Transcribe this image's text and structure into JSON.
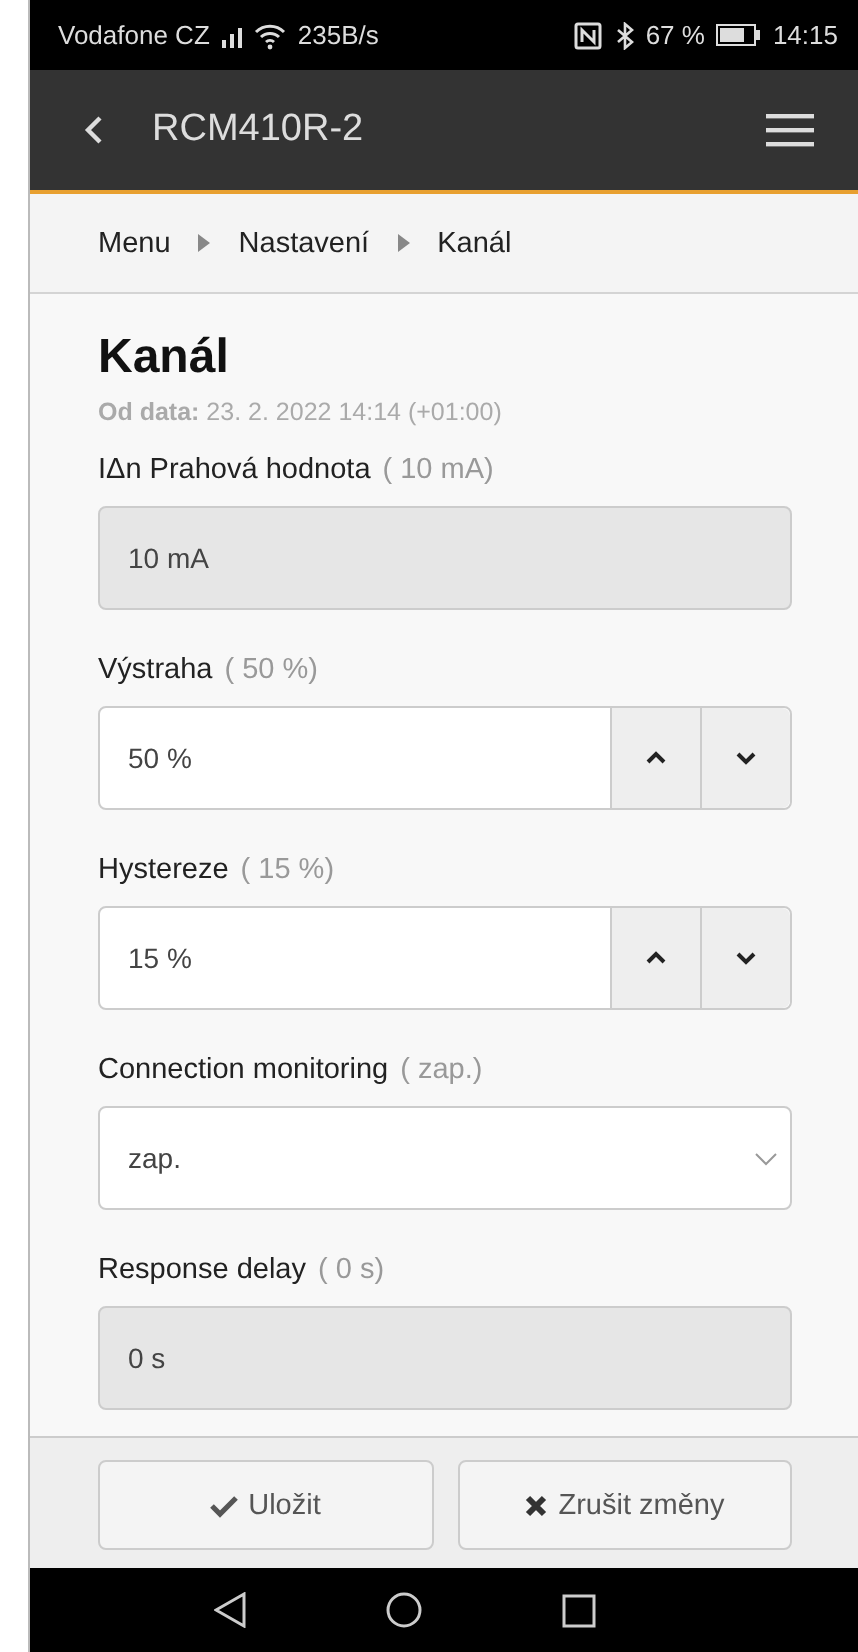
{
  "status_bar": {
    "carrier": "Vodafone CZ",
    "speed": "235B/s",
    "battery": "67 %",
    "time": "14:15"
  },
  "app_bar": {
    "title": "RCM410R-2"
  },
  "breadcrumb": [
    "Menu",
    "Nastavení",
    "Kanál"
  ],
  "page": {
    "title": "Kanál",
    "date": "**Od data:** 23. 2. 2022 14:14 (+01:00)"
  },
  "fields": [
    {
      "kind": "readonly",
      "label": "IΔn Prahová hodnota",
      "hint": "( 10 mA)",
      "value": "10 mA"
    },
    {
      "kind": "spinner",
      "label": "Výstraha",
      "hint": "( 50 %)",
      "value": "50 %"
    },
    {
      "kind": "spinner",
      "label": "Hystereze",
      "hint": "( 15 %)",
      "value": "15 %"
    },
    {
      "kind": "select",
      "label": "Connection monitoring",
      "hint": "( zap.)",
      "value": "zap."
    },
    {
      "kind": "readonly",
      "label": "Response delay",
      "hint": "( 0 s)",
      "value": "0 s"
    }
  ],
  "footer": [
    {
      "kind": "save",
      "label": "Uložit"
    },
    {
      "kind": "cancel",
      "label": "Zrušit změny"
    }
  ]
}
